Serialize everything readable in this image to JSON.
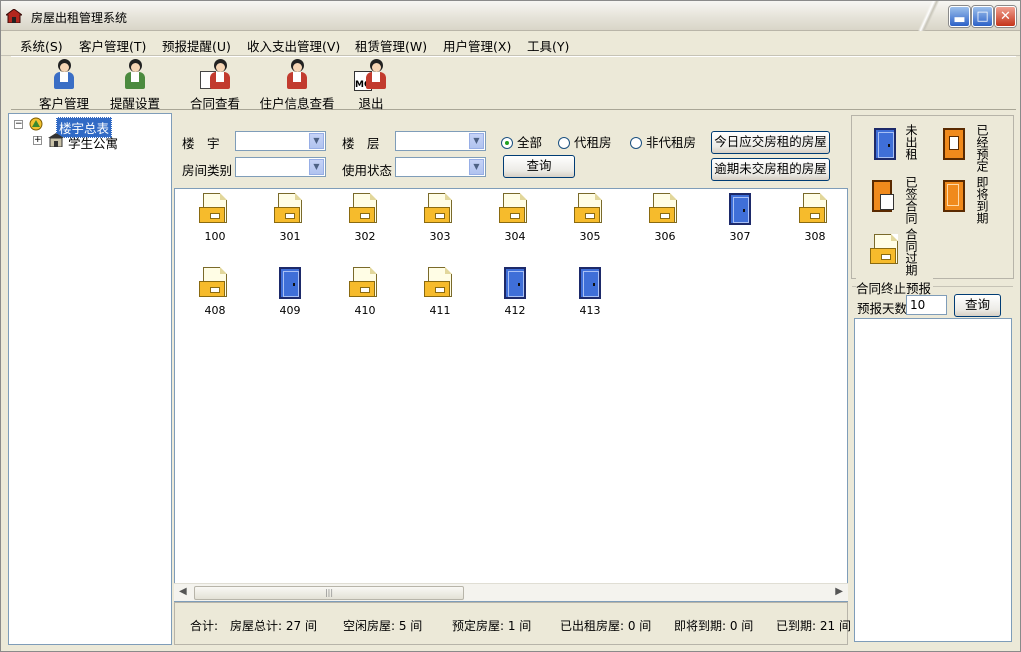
{
  "window": {
    "title": "房屋出租管理系统"
  },
  "menu": [
    "系统(S)",
    "客户管理(T)",
    "预报提醒(U)",
    "收入支出管理(V)",
    "租赁管理(W)",
    "用户管理(X)",
    "工具(Y)"
  ],
  "toolbar": {
    "customer": "客户管理",
    "reminder": "提醒设置",
    "contract": "合同查看",
    "tenant": "住户信息查看",
    "exit": "退出"
  },
  "tree": {
    "root": "楼宇总表",
    "child": "学生公寓"
  },
  "filters": {
    "building_label": "楼　宇",
    "floor_label": "楼　层",
    "room_type_label": "房间类别",
    "usage_label": "使用状态",
    "radio_all": "全部",
    "radio_agent": "代租房",
    "radio_nonagent": "非代租房",
    "query": "查询",
    "due_today": "今日应交房租的房屋",
    "overdue": "逾期未交房租的房屋"
  },
  "rooms": [
    {
      "no": "100",
      "status": "rented"
    },
    {
      "no": "301",
      "status": "rented"
    },
    {
      "no": "302",
      "status": "rented"
    },
    {
      "no": "303",
      "status": "rented"
    },
    {
      "no": "304",
      "status": "rented"
    },
    {
      "no": "305",
      "status": "rented"
    },
    {
      "no": "306",
      "status": "rented"
    },
    {
      "no": "307",
      "status": "vacant"
    },
    {
      "no": "308",
      "status": "rented"
    },
    {
      "no": "408",
      "status": "rented"
    },
    {
      "no": "409",
      "status": "vacant"
    },
    {
      "no": "410",
      "status": "rented"
    },
    {
      "no": "411",
      "status": "rented"
    },
    {
      "no": "412",
      "status": "vacant"
    },
    {
      "no": "413",
      "status": "vacant"
    }
  ],
  "status_bar": {
    "total_label": "合计:",
    "total": "房屋总计: 27 间",
    "idle": "空闲房屋: 5 间",
    "reserved": "预定房屋: 1 间",
    "rented": "已出租房屋: 0 间",
    "expiring": "即将到期: 0 间",
    "expired": "已到期: 21 间"
  },
  "legend": {
    "vacant": "未出租",
    "reserved": "已经预定",
    "signed": "已签合同",
    "expiring": "即将到期",
    "expired": "合同过期"
  },
  "forecast": {
    "title": "合同终止预报",
    "days_label": "预报天数",
    "days_value": "10",
    "query": "查询"
  }
}
